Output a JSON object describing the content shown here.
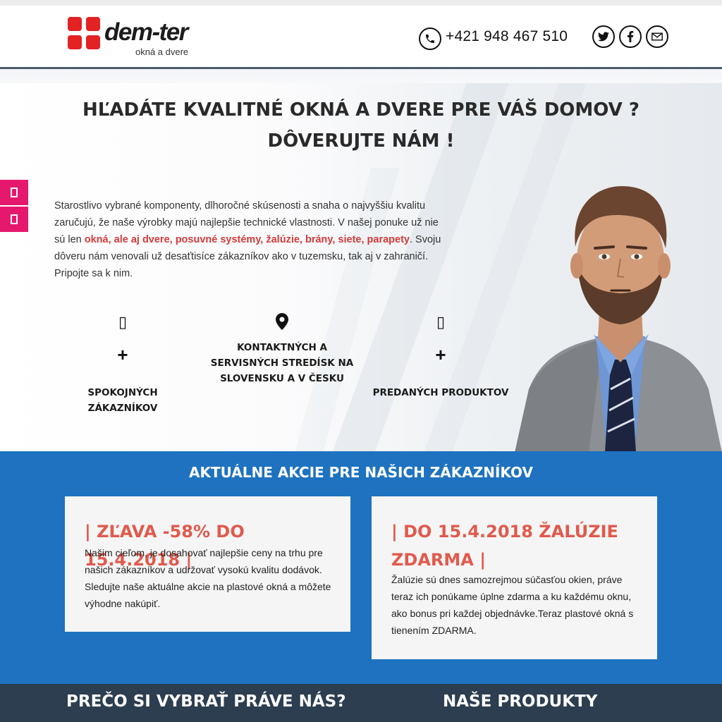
{
  "header": {
    "logo_text": "dem-ter",
    "logo_sub": "okná a dvere",
    "phone": "+421 948 467 510",
    "social_icons": [
      "twitter-icon",
      "facebook-icon",
      "mail-icon"
    ]
  },
  "hero": {
    "title_line1": "HĽADÁTE KVALITNÉ OKNÁ A DVERE PRE VÁŠ DOMOV ?",
    "title_line2": "DÔVERUJTE NÁM !",
    "paragraph_part1": "Starostlivo vybrané komponenty, dlhoročné skúsenosti a snaha o najvyššiu kvalitu zaručujú, že naše výrobky majú najlepšie technické vlastnosti. V našej ponuke už nie sú len ",
    "paragraph_highlight": "okná, ale aj dvere, posuvné systémy, žalúzie, brány, siete, parapety",
    "paragraph_part2": ". Svoju dôveru nám venovali už desaťtisíce zákazníkov ako v tuzemsku, tak aj v zahraničí. Pripojte sa k nim.",
    "stats": [
      {
        "icon_char": "▯",
        "number": "+",
        "label": "SPOKOJNÝCH ZÁKAZNÍKOV"
      },
      {
        "icon": "map-marker-icon",
        "label": "KONTAKTNÝCH A SERVISNÝCH STREDÍSK NA SLOVENSKU A V ČESKU"
      },
      {
        "icon_char": "▯",
        "number": "+",
        "label": "PREDANÝCH PRODUKTOV"
      }
    ]
  },
  "promo": {
    "title": "AKTUÁLNE AKCIE PRE NAŠICH ZÁKAZNÍKOV",
    "cards": [
      {
        "title": "| ZĽAVA -58% DO 15.4.2018 |",
        "text": "Našim cieľom, je dosahovať najlepšie ceny na trhu pre našich zákazníkov a udržovať vysokú kvalitu dodávok. Sledujte naše aktuálne akcie na plastové okná a môžete výhodne nakúpiť."
      },
      {
        "title": "| DO 15.4.2018 ŽALÚZIE ZDARMA |",
        "text": "Žalúzie sú dnes samozrejmou súčasťou okien, práve teraz ich ponúkame úplne zdarma a ku každému oknu, ako bonus pri každej objednávke.Teraz plastové okná s tienením ZDARMA."
      }
    ]
  },
  "bottom": {
    "left_heading": "PREČO SI VYBRAŤ PRÁVE NÁS?",
    "right_heading": "NAŠE PRODUKTY"
  },
  "colors": {
    "accent_red": "#e05a4d",
    "promo_blue": "#1e72c0",
    "dark_bar": "#2c3e50",
    "pink_tab": "#e5186e"
  }
}
